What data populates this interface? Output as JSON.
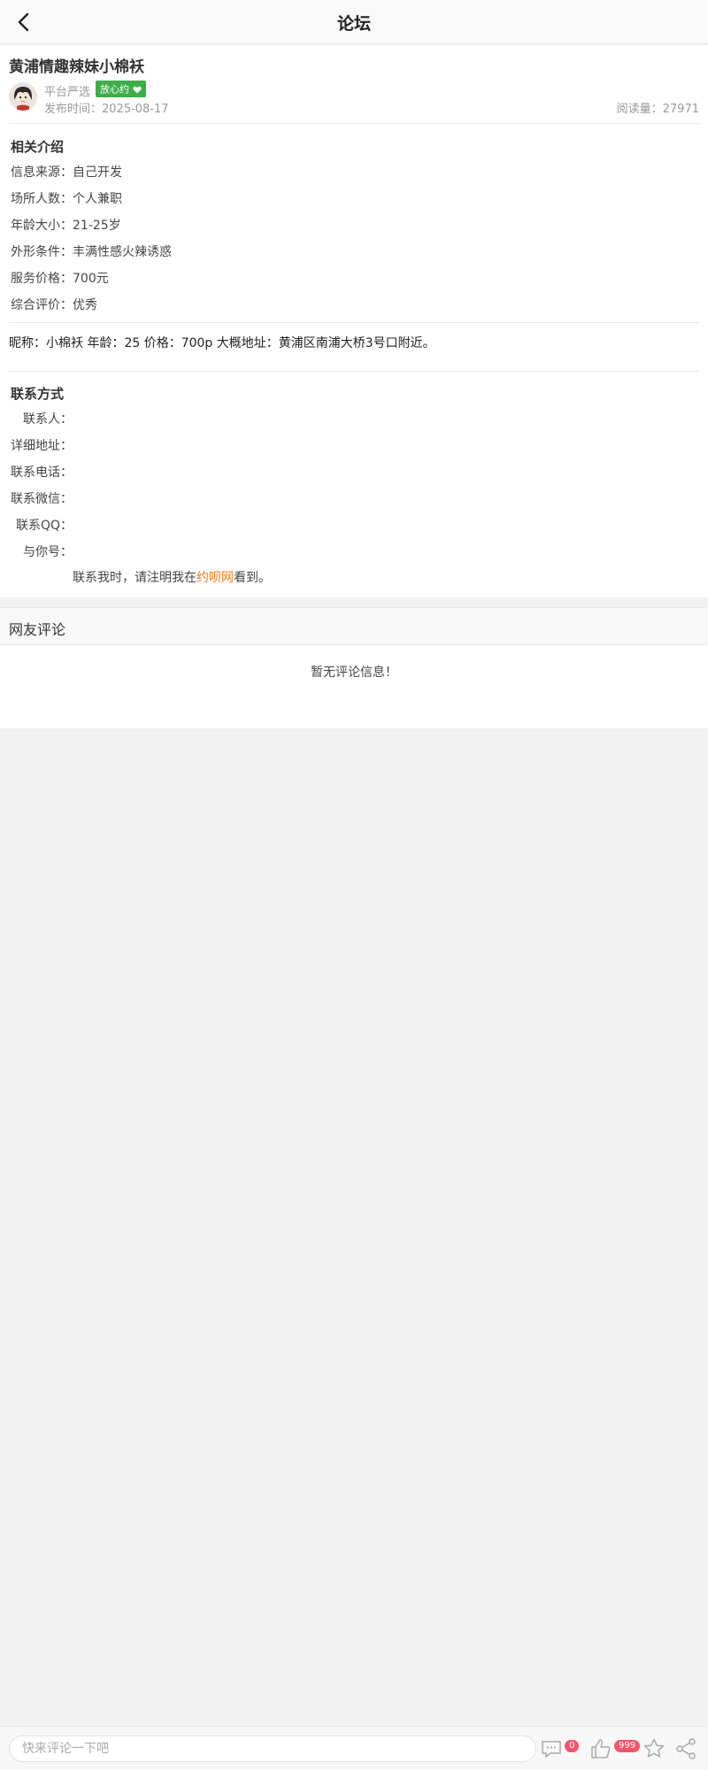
{
  "header": {
    "title": "论坛"
  },
  "post": {
    "title": "黄浦情趣辣妹小棉袄",
    "author": "平台严选",
    "badge": "放心约",
    "publish_time": "发布时间：2025-08-17",
    "read_count": "阅读量：27971"
  },
  "intro": {
    "title": "相关介绍",
    "rows": [
      "信息来源：自己开发",
      "场所人数：个人兼职",
      "年龄大小：21-25岁",
      "外形条件：丰满性感火辣诱惑",
      "服务价格：700元",
      "综合评价：优秀"
    ]
  },
  "description": "昵称：小棉袄 年龄：25 价格：700p 大概地址：黄浦区南浦大桥3号口附近。",
  "contact": {
    "title": "联系方式",
    "rows": [
      "联系人：",
      "详细地址：",
      "联系电话：",
      "联系微信：",
      "联系QQ：",
      "与你号："
    ],
    "note_prefix": "联系我时，请注明我在",
    "note_site": "约呗网",
    "note_suffix": "看到。"
  },
  "comments": {
    "title": "网友评论",
    "empty": "暂无评论信息！"
  },
  "bottom_bar": {
    "placeholder": "快来评论一下吧",
    "comment_count": "0",
    "like_count": "999",
    "icons": [
      "comment-icon",
      "like-icon",
      "star-icon",
      "share-icon"
    ]
  },
  "colors": {
    "badge_green": "#3fae49",
    "site_orange": "#f07a18",
    "count_red": "#f2556a"
  }
}
